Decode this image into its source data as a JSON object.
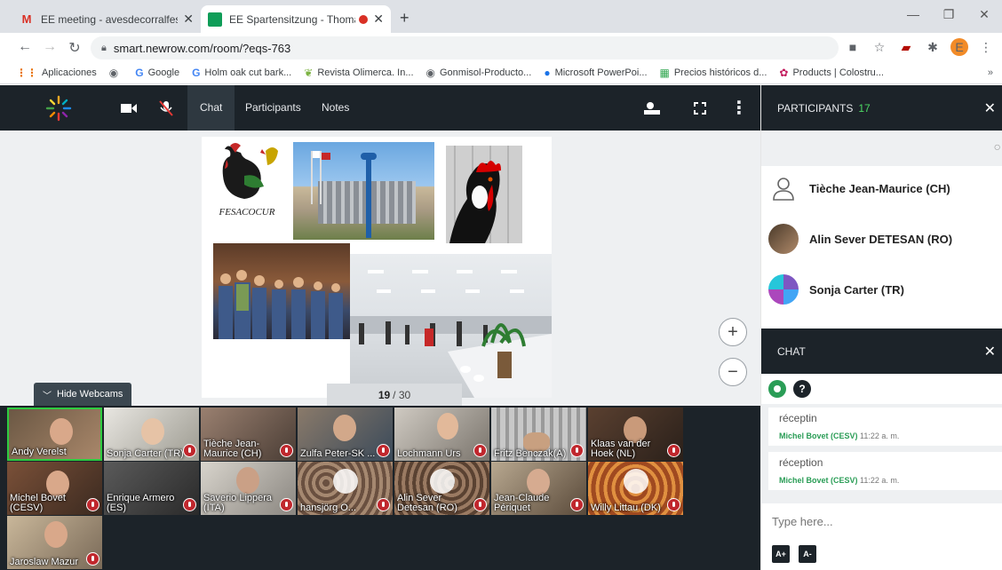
{
  "browser": {
    "tabs": [
      {
        "label": "EE meeting - avesdecorralfesaco",
        "icon": "gmail-icon",
        "active": false
      },
      {
        "label": "EE Spartensitzung - Thomas",
        "icon": "sheet-icon",
        "active": true
      }
    ],
    "url": "smart.newrow.com/room/?eqs-763",
    "bookmarks": [
      {
        "label": "Aplicaciones",
        "icon": "apps-icon"
      },
      {
        "label": "",
        "icon": "globe-icon"
      },
      {
        "label": "Google",
        "icon": "google-icon"
      },
      {
        "label": "Holm oak cut bark...",
        "icon": "google-icon"
      },
      {
        "label": "Revista Olimerca. In...",
        "icon": "leaf-icon"
      },
      {
        "label": "Gonmisol-Producto...",
        "icon": "globe-icon"
      },
      {
        "label": "Microsoft PowerPoi...",
        "icon": "ppt-icon"
      },
      {
        "label": "Precios históricos d...",
        "icon": "grid-icon"
      },
      {
        "label": "Products | Colostru...",
        "icon": "product-icon"
      }
    ],
    "profile_initial": "E"
  },
  "app": {
    "tabs": [
      {
        "label": "Chat",
        "active": true
      },
      {
        "label": "Participants",
        "active": false
      },
      {
        "label": "Notes",
        "active": false
      }
    ]
  },
  "participants_panel": {
    "title": "PARTICIPANTS",
    "count": "17",
    "people": [
      {
        "name": "Tièche Jean-Maurice (CH)"
      },
      {
        "name": "Alin Sever DETESAN (RO)"
      },
      {
        "name": "Sonja Carter (TR)"
      }
    ]
  },
  "chat_panel": {
    "title": "CHAT",
    "messages": [
      {
        "text": "réceptin",
        "author": "Michel Bovet (CESV)",
        "time": "11:22 a. m."
      },
      {
        "text": "réception",
        "author": "Michel Bovet (CESV)",
        "time": "11:22 a. m."
      }
    ],
    "input_placeholder": "Type here...",
    "font_increase": "A+",
    "font_decrease": "A-"
  },
  "slide": {
    "logo_text": "FESACOCUR",
    "page_current": "19",
    "page_total": "/ 30"
  },
  "stage": {
    "hide_webcams_label": "Hide Webcams"
  },
  "webcams": [
    {
      "name": "Andy Verelst",
      "mic_off": false
    },
    {
      "name": "Sonja Carter (TR)",
      "mic_off": true
    },
    {
      "name": "Tièche Jean-Maurice (CH)",
      "mic_off": true
    },
    {
      "name": "Zulfa Peter-SK ...",
      "mic_off": true
    },
    {
      "name": "Lochmann Urs",
      "mic_off": true
    },
    {
      "name": "Fritz Benczak(A)",
      "mic_off": true
    },
    {
      "name": "Klaas van der Hoek (NL)",
      "mic_off": true
    },
    {
      "name": "Michel Bovet (CESV)",
      "mic_off": true
    },
    {
      "name": "Enrique Armero (ES)",
      "mic_off": true
    },
    {
      "name": "Saverio Lippera (ITA)",
      "mic_off": true
    },
    {
      "name": "hansjörg O...",
      "mic_off": true
    },
    {
      "name": "Alin Sever Detesan (RO)",
      "mic_off": true
    },
    {
      "name": "Jean-Claude Périquet",
      "mic_off": true
    },
    {
      "name": "Willy Littau (DK)",
      "mic_off": true
    },
    {
      "name": "Jaroslaw Mazur",
      "mic_off": true
    }
  ],
  "colors": {
    "app_dark": "#1c2329",
    "accent_green": "#4cd964",
    "mic_red": "#c0272d"
  }
}
